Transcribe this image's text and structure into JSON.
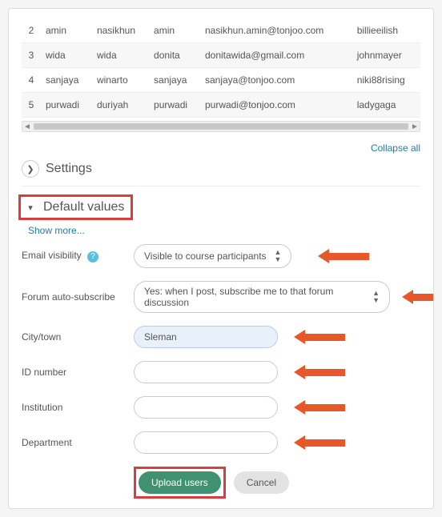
{
  "table": {
    "rows": [
      {
        "idx": "2",
        "c1": "amin",
        "c2": "nasikhun",
        "c3": "amin",
        "email": "nasikhun.amin@tonjoo.com",
        "c5": "billieeilish"
      },
      {
        "idx": "3",
        "c1": "wida",
        "c2": "wida",
        "c3": "donita",
        "email": "donitawida@gmail.com",
        "c5": "johnmayer"
      },
      {
        "idx": "4",
        "c1": "sanjaya",
        "c2": "winarto",
        "c3": "sanjaya",
        "email": "sanjaya@tonjoo.com",
        "c5": "niki88rising"
      },
      {
        "idx": "5",
        "c1": "purwadi",
        "c2": "duriyah",
        "c3": "purwadi",
        "email": "purwadi@tonjoo.com",
        "c5": "ladygaga"
      }
    ]
  },
  "collapse_all_label": "Collapse all",
  "settings": {
    "title": "Settings"
  },
  "default_values": {
    "title": "Default values"
  },
  "show_more_label": "Show more...",
  "fields": {
    "email_visibility": {
      "label": "Email visibility",
      "value": "Visible to course participants"
    },
    "forum_auto": {
      "label": "Forum auto-subscribe",
      "value": "Yes: when I post, subscribe me to that forum discussion"
    },
    "city": {
      "label": "City/town",
      "value": "Sleman"
    },
    "idnumber": {
      "label": "ID number",
      "value": ""
    },
    "institution": {
      "label": "Institution",
      "value": ""
    },
    "department": {
      "label": "Department",
      "value": ""
    }
  },
  "buttons": {
    "upload": "Upload users",
    "cancel": "Cancel"
  }
}
